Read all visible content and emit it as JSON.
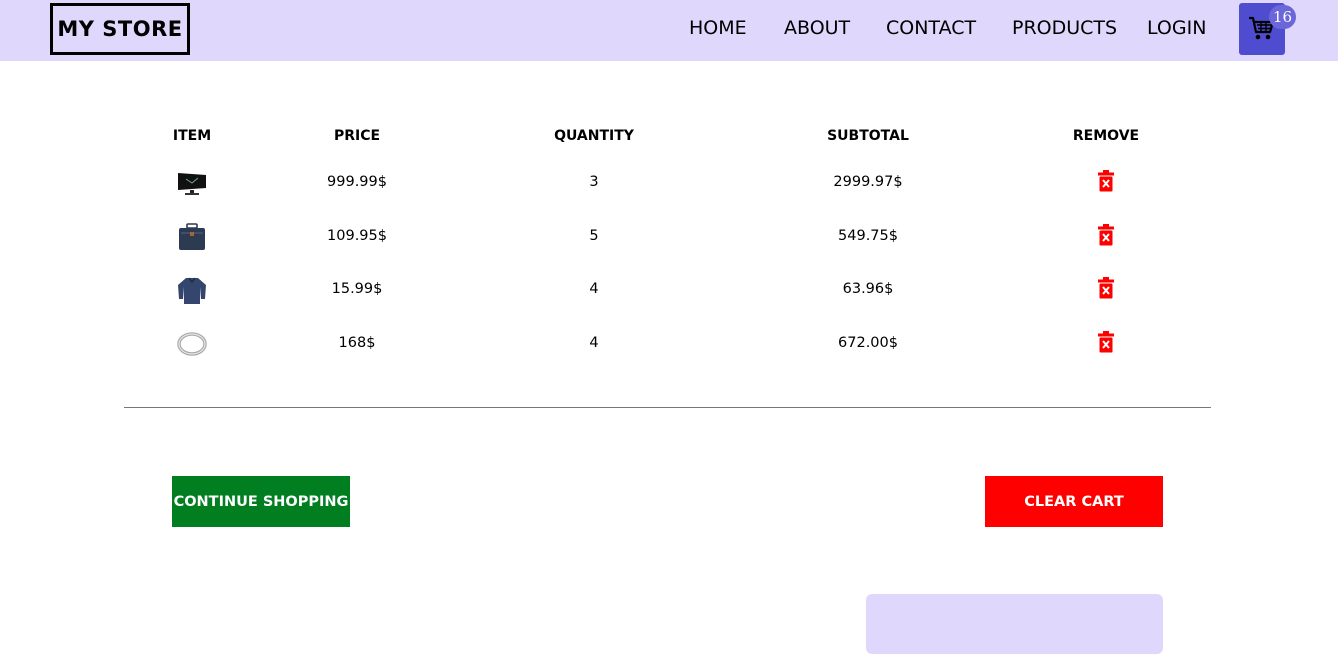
{
  "navbar": {
    "logo": "MY STORE",
    "links": [
      "HOME",
      "ABOUT",
      "CONTACT",
      "PRODUCTS",
      "LOGIN"
    ],
    "cart_count": "16",
    "cart_icon": "shopping-cart-icon",
    "background": "#dfd8fc",
    "cart_color": "#4f4ccf"
  },
  "cart_table": {
    "headers": [
      "ITEM",
      "PRICE",
      "QUANTITY",
      "SUBTOTAL",
      "REMOVE"
    ],
    "rows": [
      {
        "item_icon": "monitor-thumbnail",
        "price": "999.99$",
        "quantity": "3",
        "subtotal": "2999.97$"
      },
      {
        "item_icon": "backpack-thumbnail",
        "price": "109.95$",
        "quantity": "5",
        "subtotal": "549.75$"
      },
      {
        "item_icon": "jacket-thumbnail",
        "price": "15.99$",
        "quantity": "4",
        "subtotal": "63.96$"
      },
      {
        "item_icon": "ring-thumbnail",
        "price": "168$",
        "quantity": "4",
        "subtotal": "672.00$"
      }
    ],
    "remove_icon": "trash-icon",
    "remove_color": "#ff0000"
  },
  "actions": {
    "continue_label": "CONTINUE SHOPPING",
    "continue_color": "#007e20",
    "clear_label": "CLEAR CART",
    "clear_color": "#ff0000"
  }
}
